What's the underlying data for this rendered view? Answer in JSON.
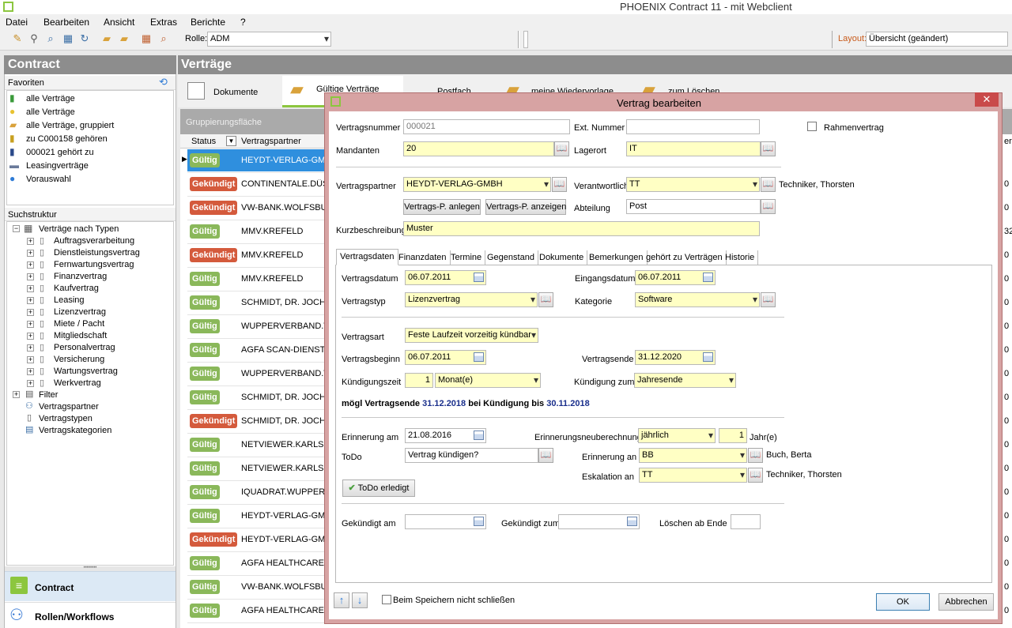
{
  "window": {
    "title": "PHOENIX Contract 11 - mit Webclient"
  },
  "menu": {
    "datei": "Datei",
    "bearbeiten": "Bearbeiten",
    "ansicht": "Ansicht",
    "extras": "Extras",
    "berichte": "Berichte",
    "help": "?"
  },
  "toolbar": {
    "rolle_label": "Rolle:",
    "rolle_value": "ADM",
    "layout_label": "Layout:",
    "layout_value": "Übersicht (geändert)"
  },
  "left": {
    "title": "Contract",
    "favoriten": "Favoriten",
    "fav": [
      "alle Verträge",
      "alle Verträge",
      "alle Verträge, gruppiert",
      "zu C000158 gehören",
      "000021 gehört zu",
      "Leasingverträge",
      "Vorauswahl"
    ],
    "suchstruktur": "Suchstruktur",
    "root": "Verträge nach Typen",
    "types": [
      "Auftragsverarbeitung",
      "Dienstleistungsvertrag",
      "Fernwartungsvertrag",
      "Finanzvertrag",
      "Kaufvertrag",
      "Leasing",
      "Lizenzvertrag",
      "Miete / Pacht",
      "Mitgliedschaft",
      "Personalvertrag",
      "Versicherung",
      "Wartungsvertrag",
      "Werkvertrag"
    ],
    "others": [
      "Filter",
      "Vertragspartner",
      "Vertragstypen",
      "Vertragskategorien"
    ],
    "nav": {
      "contract": "Contract",
      "rollen": "Rollen/Workflows"
    }
  },
  "main": {
    "title": "Verträge",
    "tabs": {
      "dokumente": "Dokumente",
      "gueltige": "Gültige Verträge",
      "postfach": "Postfach",
      "wiedervorlage": "meine Wiedervorlage",
      "loeschen": "zum Löschen"
    },
    "group_area": "Gruppierungsfläche",
    "col_status": "Status",
    "col_partner": "Vertragspartner",
    "rows": [
      [
        "Gültig",
        "HEYDT-VERLAG-GMB"
      ],
      [
        "Gekündigt",
        "CONTINENTALE.DÜSS"
      ],
      [
        "Gekündigt",
        "VW-BANK.WOLFSBUR"
      ],
      [
        "Gültig",
        "MMV.KREFELD"
      ],
      [
        "Gekündigt",
        "MMV.KREFELD"
      ],
      [
        "Gültig",
        "MMV.KREFELD"
      ],
      [
        "Gültig",
        "SCHMIDT, DR. JOCHE"
      ],
      [
        "Gültig",
        "WUPPERVERBAND.W"
      ],
      [
        "Gültig",
        "AGFA SCAN-DIENSTL"
      ],
      [
        "Gültig",
        "WUPPERVERBAND.W"
      ],
      [
        "Gültig",
        "SCHMIDT, DR. JOCHE"
      ],
      [
        "Gekündigt",
        "SCHMIDT, DR. JOCHE"
      ],
      [
        "Gültig",
        "NETVIEWER.KARLSR"
      ],
      [
        "Gültig",
        "NETVIEWER.KARLSR"
      ],
      [
        "Gültig",
        "IQUADRAT.WUPPERT"
      ],
      [
        "Gültig",
        "HEYDT-VERLAG-GMB"
      ],
      [
        "Gekündigt",
        "HEYDT-VERLAG-GMB"
      ],
      [
        "Gültig",
        "AGFA HEALTHCARE"
      ],
      [
        "Gültig",
        "VW-BANK.WOLFSBUR"
      ],
      [
        "Gültig",
        "AGFA HEALTHCARE"
      ]
    ],
    "edge": [
      "er",
      "0",
      "0",
      "0",
      "32",
      "0",
      "0",
      "0",
      "0",
      "0",
      "0",
      "0",
      "0",
      "0",
      "0",
      "0",
      "0",
      "0",
      "0",
      "0",
      "0"
    ]
  },
  "dialog": {
    "title": "Vertrag bearbeiten",
    "vertragsnummer_label": "Vertragsnummer",
    "vertragsnummer": "000021",
    "extnummer_label": "Ext. Nummer",
    "extnummer": "",
    "rahmenvertrag": "Rahmenvertrag",
    "mandanten_label": "Mandanten",
    "mandanten": "20",
    "lagerort_label": "Lagerort",
    "lagerort": "IT",
    "vertragspartner_label": "Vertragspartner",
    "vertragspartner": "HEYDT-VERLAG-GMBH",
    "verantwortlich_label": "Verantwortlich",
    "verantwortlich": "TT",
    "verantwortlich_name": "Techniker, Thorsten",
    "btn_anlegen": "Vertrags-P. anlegen",
    "btn_anzeigen": "Vertrags-P. anzeigen",
    "abteilung_label": "Abteilung",
    "abteilung": "Post",
    "kurz_label": "Kurzbeschreibung",
    "kurz": "Muster",
    "tabs": [
      "Vertragsdaten",
      "Finanzdaten",
      "Termine",
      "Gegenstand",
      "Dokumente",
      "Bemerkungen",
      "gehört zu Verträgen",
      "Historie"
    ],
    "vertragsdatum_label": "Vertragsdatum",
    "vertragsdatum": "06.07.2011",
    "eingangsdatum_label": "Eingangsdatum",
    "eingangsdatum": "06.07.2011",
    "vertragstyp_label": "Vertragstyp",
    "vertragstyp": "Lizenzvertrag",
    "kategorie_label": "Kategorie",
    "kategorie": "Software",
    "vertragsart_label": "Vertragsart",
    "vertragsart": "Feste Laufzeit vorzeitig kündbar",
    "vertragsbeginn_label": "Vertragsbeginn",
    "vertragsbeginn": "06.07.2011",
    "vertragsende_label": "Vertragsende",
    "vertragsende": "31.12.2020",
    "kuendigungszeit_label": "Kündigungszeit",
    "kuendigungszeit_num": "1",
    "kuendigungszeit_unit": "Monat(e)",
    "kuendigung_zum_label": "Kündigung zum",
    "kuendigung_zum": "Jahresende",
    "moegl_prefix": "mögl Vertragsende",
    "moegl_date": "31.12.2018",
    "moegl_mid": "bei Kündigung bis",
    "moegl_date2": "30.11.2018",
    "erinnerung_label": "Erinnerung am",
    "erinnerung": "21.08.2016",
    "neuberechnung_label": "Erinnerungsneuberechnung",
    "neuberechnung": "jährlich",
    "neuberechnung_num": "1",
    "neuberechnung_unit": "Jahr(e)",
    "todo_label": "ToDo",
    "todo": "Vertrag kündigen?",
    "erinnerung_an_label": "Erinnerung an",
    "erinnerung_an": "BB",
    "erinnerung_an_name": "Buch, Berta",
    "eskalation_label": "Eskalation an",
    "eskalation": "TT",
    "eskalation_name": "Techniker, Thorsten",
    "todo_erledigt": "ToDo erledigt",
    "gekuendigt_am_label": "Gekündigt am",
    "gekuendigt_zum_label": "Gekündigt zum",
    "loeschen_label": "Löschen ab Ende",
    "beim_speichern": "Beim Speichern nicht schließen",
    "ok": "OK",
    "abbrechen": "Abbrechen"
  }
}
